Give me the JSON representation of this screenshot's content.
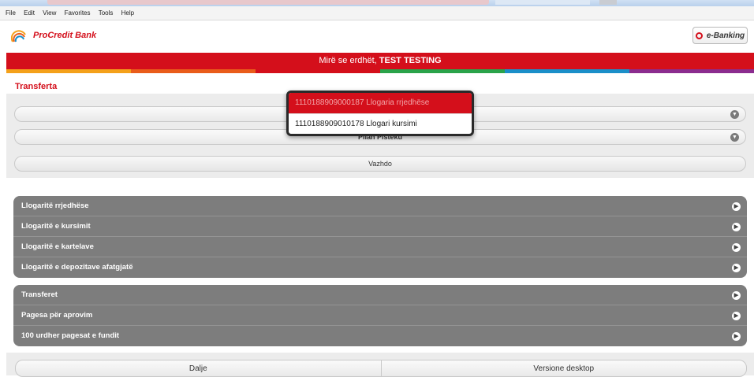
{
  "browser": {
    "menu": [
      "File",
      "Edit",
      "View",
      "Favorites",
      "Tools",
      "Help"
    ]
  },
  "header": {
    "brand": "ProCredit Bank",
    "ebanking_label": "e-Banking"
  },
  "welcome": {
    "greeting": "Mirë se erdhët, ",
    "user": "TEST TESTING"
  },
  "stripe_colors": [
    "#f4a11a",
    "#e95c1a",
    "#d40f1b",
    "#2aa34a",
    "#1b8fc9",
    "#8b2c8f"
  ],
  "transfer": {
    "title": "Transferta",
    "account_select": "",
    "beneficiary_select": "Pllan Pisteku",
    "continue_label": "Vazhdo"
  },
  "dropdown": {
    "options": [
      "1110188909000187 Llogaria rrjedhëse",
      "1110188909010178 Llogari kursimi"
    ]
  },
  "accounts_menu": [
    "Llogaritë rrjedhëse",
    "Llogaritë e kursimit",
    "Llogaritë e kartelave",
    "Llogaritë e depozitave afatgjatë"
  ],
  "transfers_menu": [
    "Transferet",
    "Pagesa për aprovim",
    "100 urdher pagesat e fundit"
  ],
  "footer": {
    "logout_label": "Dalje",
    "desktop_label": "Versione desktop"
  }
}
